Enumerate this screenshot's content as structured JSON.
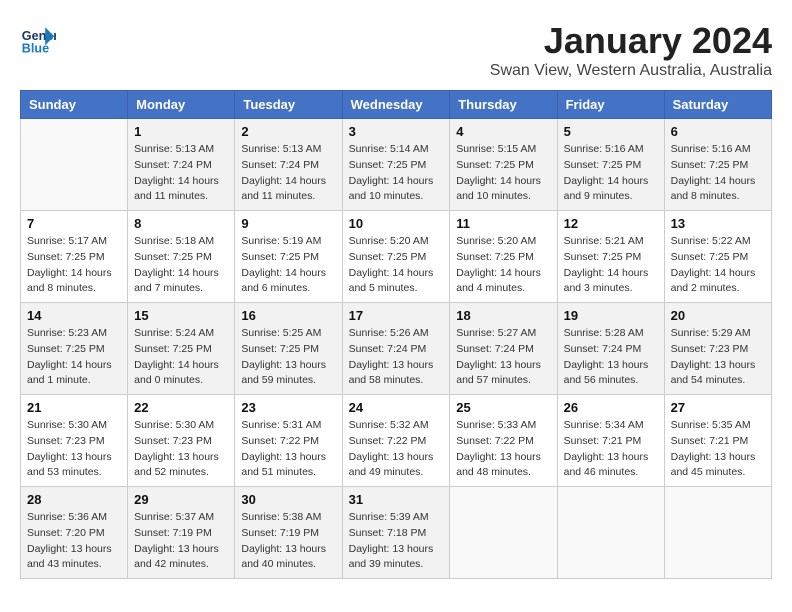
{
  "header": {
    "logo_line1": "General",
    "logo_line2": "Blue",
    "month": "January 2024",
    "location": "Swan View, Western Australia, Australia"
  },
  "weekdays": [
    "Sunday",
    "Monday",
    "Tuesday",
    "Wednesday",
    "Thursday",
    "Friday",
    "Saturday"
  ],
  "weeks": [
    [
      {
        "day": "",
        "detail": ""
      },
      {
        "day": "1",
        "detail": "Sunrise: 5:13 AM\nSunset: 7:24 PM\nDaylight: 14 hours\nand 11 minutes."
      },
      {
        "day": "2",
        "detail": "Sunrise: 5:13 AM\nSunset: 7:24 PM\nDaylight: 14 hours\nand 11 minutes."
      },
      {
        "day": "3",
        "detail": "Sunrise: 5:14 AM\nSunset: 7:25 PM\nDaylight: 14 hours\nand 10 minutes."
      },
      {
        "day": "4",
        "detail": "Sunrise: 5:15 AM\nSunset: 7:25 PM\nDaylight: 14 hours\nand 10 minutes."
      },
      {
        "day": "5",
        "detail": "Sunrise: 5:16 AM\nSunset: 7:25 PM\nDaylight: 14 hours\nand 9 minutes."
      },
      {
        "day": "6",
        "detail": "Sunrise: 5:16 AM\nSunset: 7:25 PM\nDaylight: 14 hours\nand 8 minutes."
      }
    ],
    [
      {
        "day": "7",
        "detail": "Sunrise: 5:17 AM\nSunset: 7:25 PM\nDaylight: 14 hours\nand 8 minutes."
      },
      {
        "day": "8",
        "detail": "Sunrise: 5:18 AM\nSunset: 7:25 PM\nDaylight: 14 hours\nand 7 minutes."
      },
      {
        "day": "9",
        "detail": "Sunrise: 5:19 AM\nSunset: 7:25 PM\nDaylight: 14 hours\nand 6 minutes."
      },
      {
        "day": "10",
        "detail": "Sunrise: 5:20 AM\nSunset: 7:25 PM\nDaylight: 14 hours\nand 5 minutes."
      },
      {
        "day": "11",
        "detail": "Sunrise: 5:20 AM\nSunset: 7:25 PM\nDaylight: 14 hours\nand 4 minutes."
      },
      {
        "day": "12",
        "detail": "Sunrise: 5:21 AM\nSunset: 7:25 PM\nDaylight: 14 hours\nand 3 minutes."
      },
      {
        "day": "13",
        "detail": "Sunrise: 5:22 AM\nSunset: 7:25 PM\nDaylight: 14 hours\nand 2 minutes."
      }
    ],
    [
      {
        "day": "14",
        "detail": "Sunrise: 5:23 AM\nSunset: 7:25 PM\nDaylight: 14 hours\nand 1 minute."
      },
      {
        "day": "15",
        "detail": "Sunrise: 5:24 AM\nSunset: 7:25 PM\nDaylight: 14 hours\nand 0 minutes."
      },
      {
        "day": "16",
        "detail": "Sunrise: 5:25 AM\nSunset: 7:25 PM\nDaylight: 13 hours\nand 59 minutes."
      },
      {
        "day": "17",
        "detail": "Sunrise: 5:26 AM\nSunset: 7:24 PM\nDaylight: 13 hours\nand 58 minutes."
      },
      {
        "day": "18",
        "detail": "Sunrise: 5:27 AM\nSunset: 7:24 PM\nDaylight: 13 hours\nand 57 minutes."
      },
      {
        "day": "19",
        "detail": "Sunrise: 5:28 AM\nSunset: 7:24 PM\nDaylight: 13 hours\nand 56 minutes."
      },
      {
        "day": "20",
        "detail": "Sunrise: 5:29 AM\nSunset: 7:23 PM\nDaylight: 13 hours\nand 54 minutes."
      }
    ],
    [
      {
        "day": "21",
        "detail": "Sunrise: 5:30 AM\nSunset: 7:23 PM\nDaylight: 13 hours\nand 53 minutes."
      },
      {
        "day": "22",
        "detail": "Sunrise: 5:30 AM\nSunset: 7:23 PM\nDaylight: 13 hours\nand 52 minutes."
      },
      {
        "day": "23",
        "detail": "Sunrise: 5:31 AM\nSunset: 7:22 PM\nDaylight: 13 hours\nand 51 minutes."
      },
      {
        "day": "24",
        "detail": "Sunrise: 5:32 AM\nSunset: 7:22 PM\nDaylight: 13 hours\nand 49 minutes."
      },
      {
        "day": "25",
        "detail": "Sunrise: 5:33 AM\nSunset: 7:22 PM\nDaylight: 13 hours\nand 48 minutes."
      },
      {
        "day": "26",
        "detail": "Sunrise: 5:34 AM\nSunset: 7:21 PM\nDaylight: 13 hours\nand 46 minutes."
      },
      {
        "day": "27",
        "detail": "Sunrise: 5:35 AM\nSunset: 7:21 PM\nDaylight: 13 hours\nand 45 minutes."
      }
    ],
    [
      {
        "day": "28",
        "detail": "Sunrise: 5:36 AM\nSunset: 7:20 PM\nDaylight: 13 hours\nand 43 minutes."
      },
      {
        "day": "29",
        "detail": "Sunrise: 5:37 AM\nSunset: 7:19 PM\nDaylight: 13 hours\nand 42 minutes."
      },
      {
        "day": "30",
        "detail": "Sunrise: 5:38 AM\nSunset: 7:19 PM\nDaylight: 13 hours\nand 40 minutes."
      },
      {
        "day": "31",
        "detail": "Sunrise: 5:39 AM\nSunset: 7:18 PM\nDaylight: 13 hours\nand 39 minutes."
      },
      {
        "day": "",
        "detail": ""
      },
      {
        "day": "",
        "detail": ""
      },
      {
        "day": "",
        "detail": ""
      }
    ]
  ]
}
